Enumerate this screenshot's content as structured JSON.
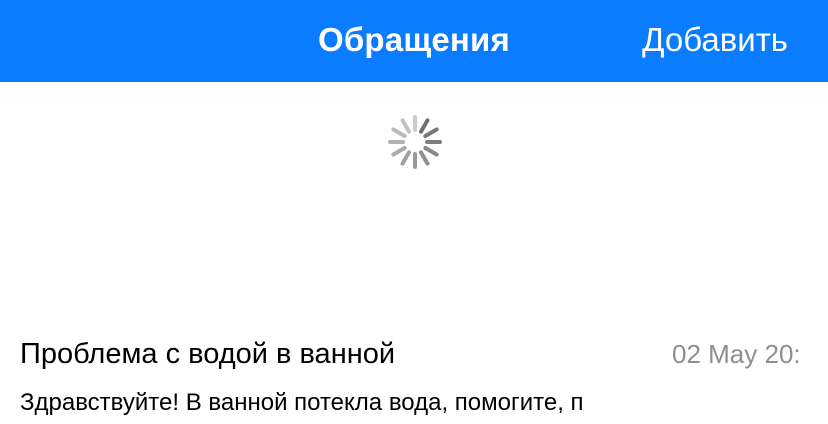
{
  "navbar": {
    "title": "Обращения",
    "add_label": "Добавить",
    "background_color": "#0a7cff"
  },
  "loading": {
    "icon": "activity-spinner-icon"
  },
  "requests": {
    "items": [
      {
        "title": "Проблема с водой в ванной",
        "date": "02 May 20:",
        "preview": "Здравствуйте! В ванной потекла вода, помогите, п"
      }
    ]
  }
}
